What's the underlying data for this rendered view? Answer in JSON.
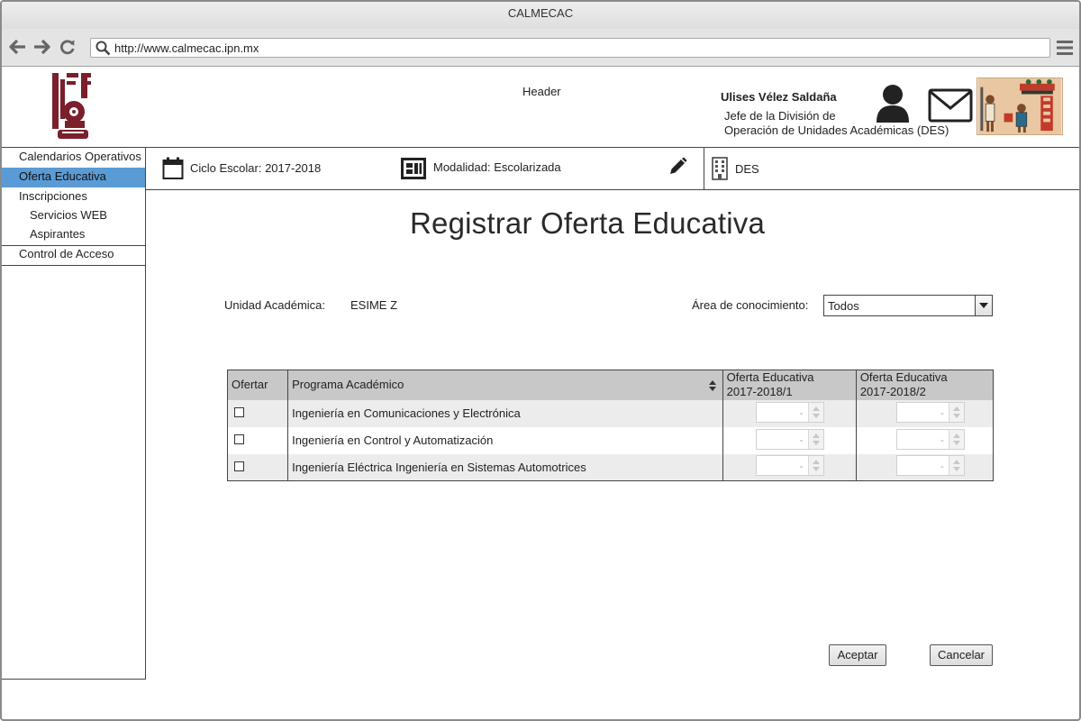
{
  "window": {
    "title": "CALMECAC"
  },
  "browser": {
    "url": "http://www.calmecac.ipn.mx"
  },
  "header": {
    "label": "Header",
    "user_name": "Ulises Vélez Saldaña",
    "user_role_line1": "Jefe de la División de",
    "user_role_line2": "Operación de Unidades Académicas (DES)"
  },
  "sidebar": {
    "items": [
      {
        "label": "Calendarios Operativos",
        "active": false
      },
      {
        "label": "Oferta Educativa",
        "active": true
      },
      {
        "label": "Inscripciones",
        "active": false
      },
      {
        "label": "Servicios WEB",
        "active": false
      },
      {
        "label": "Aspirantes",
        "active": false
      },
      {
        "label": "Control de Acceso",
        "active": false
      }
    ]
  },
  "infobar": {
    "ciclo": "Ciclo Escolar: 2017-2018",
    "modalidad": "Modalidad: Escolarizada",
    "dependencia": "DES"
  },
  "main": {
    "title": "Registrar Oferta Educativa",
    "unidad_label": "Unidad Académica:",
    "unidad_value": "ESIME Z",
    "area_label": "Área de conocimiento:",
    "area_value": "Todos",
    "table": {
      "headers": {
        "ofertar": "Ofertar",
        "programa": "Programa Académico",
        "oferta1_line1": "Oferta Educativa",
        "oferta1_line2": "2017-2018/1",
        "oferta2_line1": "Oferta Educativa",
        "oferta2_line2": "2017-2018/2"
      },
      "rows": [
        {
          "programa": "Ingeniería en Comunicaciones y Electrónica",
          "oferta1": "-",
          "oferta2": "-"
        },
        {
          "programa": "Ingeniería en Control y Automatización",
          "oferta1": "-",
          "oferta2": "-"
        },
        {
          "programa": "Ingeniería Eléctrica Ingeniería en Sistemas Automotrices",
          "oferta1": "-",
          "oferta2": "-"
        }
      ]
    },
    "accept_label": "Aceptar",
    "cancel_label": "Cancelar"
  },
  "icons": {
    "back": "arrow-left-icon",
    "forward": "arrow-right-icon",
    "reload": "reload-icon",
    "search": "search-icon",
    "menu": "hamburger-menu-icon",
    "logo": "ipn-logo",
    "user": "user-icon",
    "mail": "mail-icon",
    "calendar": "calendar-icon",
    "modalidad": "dashboard-icon",
    "edit": "pencil-icon",
    "building": "building-icon",
    "sort": "sort-icon"
  },
  "colors": {
    "accent": "#5b9bd5",
    "logo": "#7a1f2b",
    "header_bg": "#c8c8c8",
    "row_alt": "#ececec"
  }
}
